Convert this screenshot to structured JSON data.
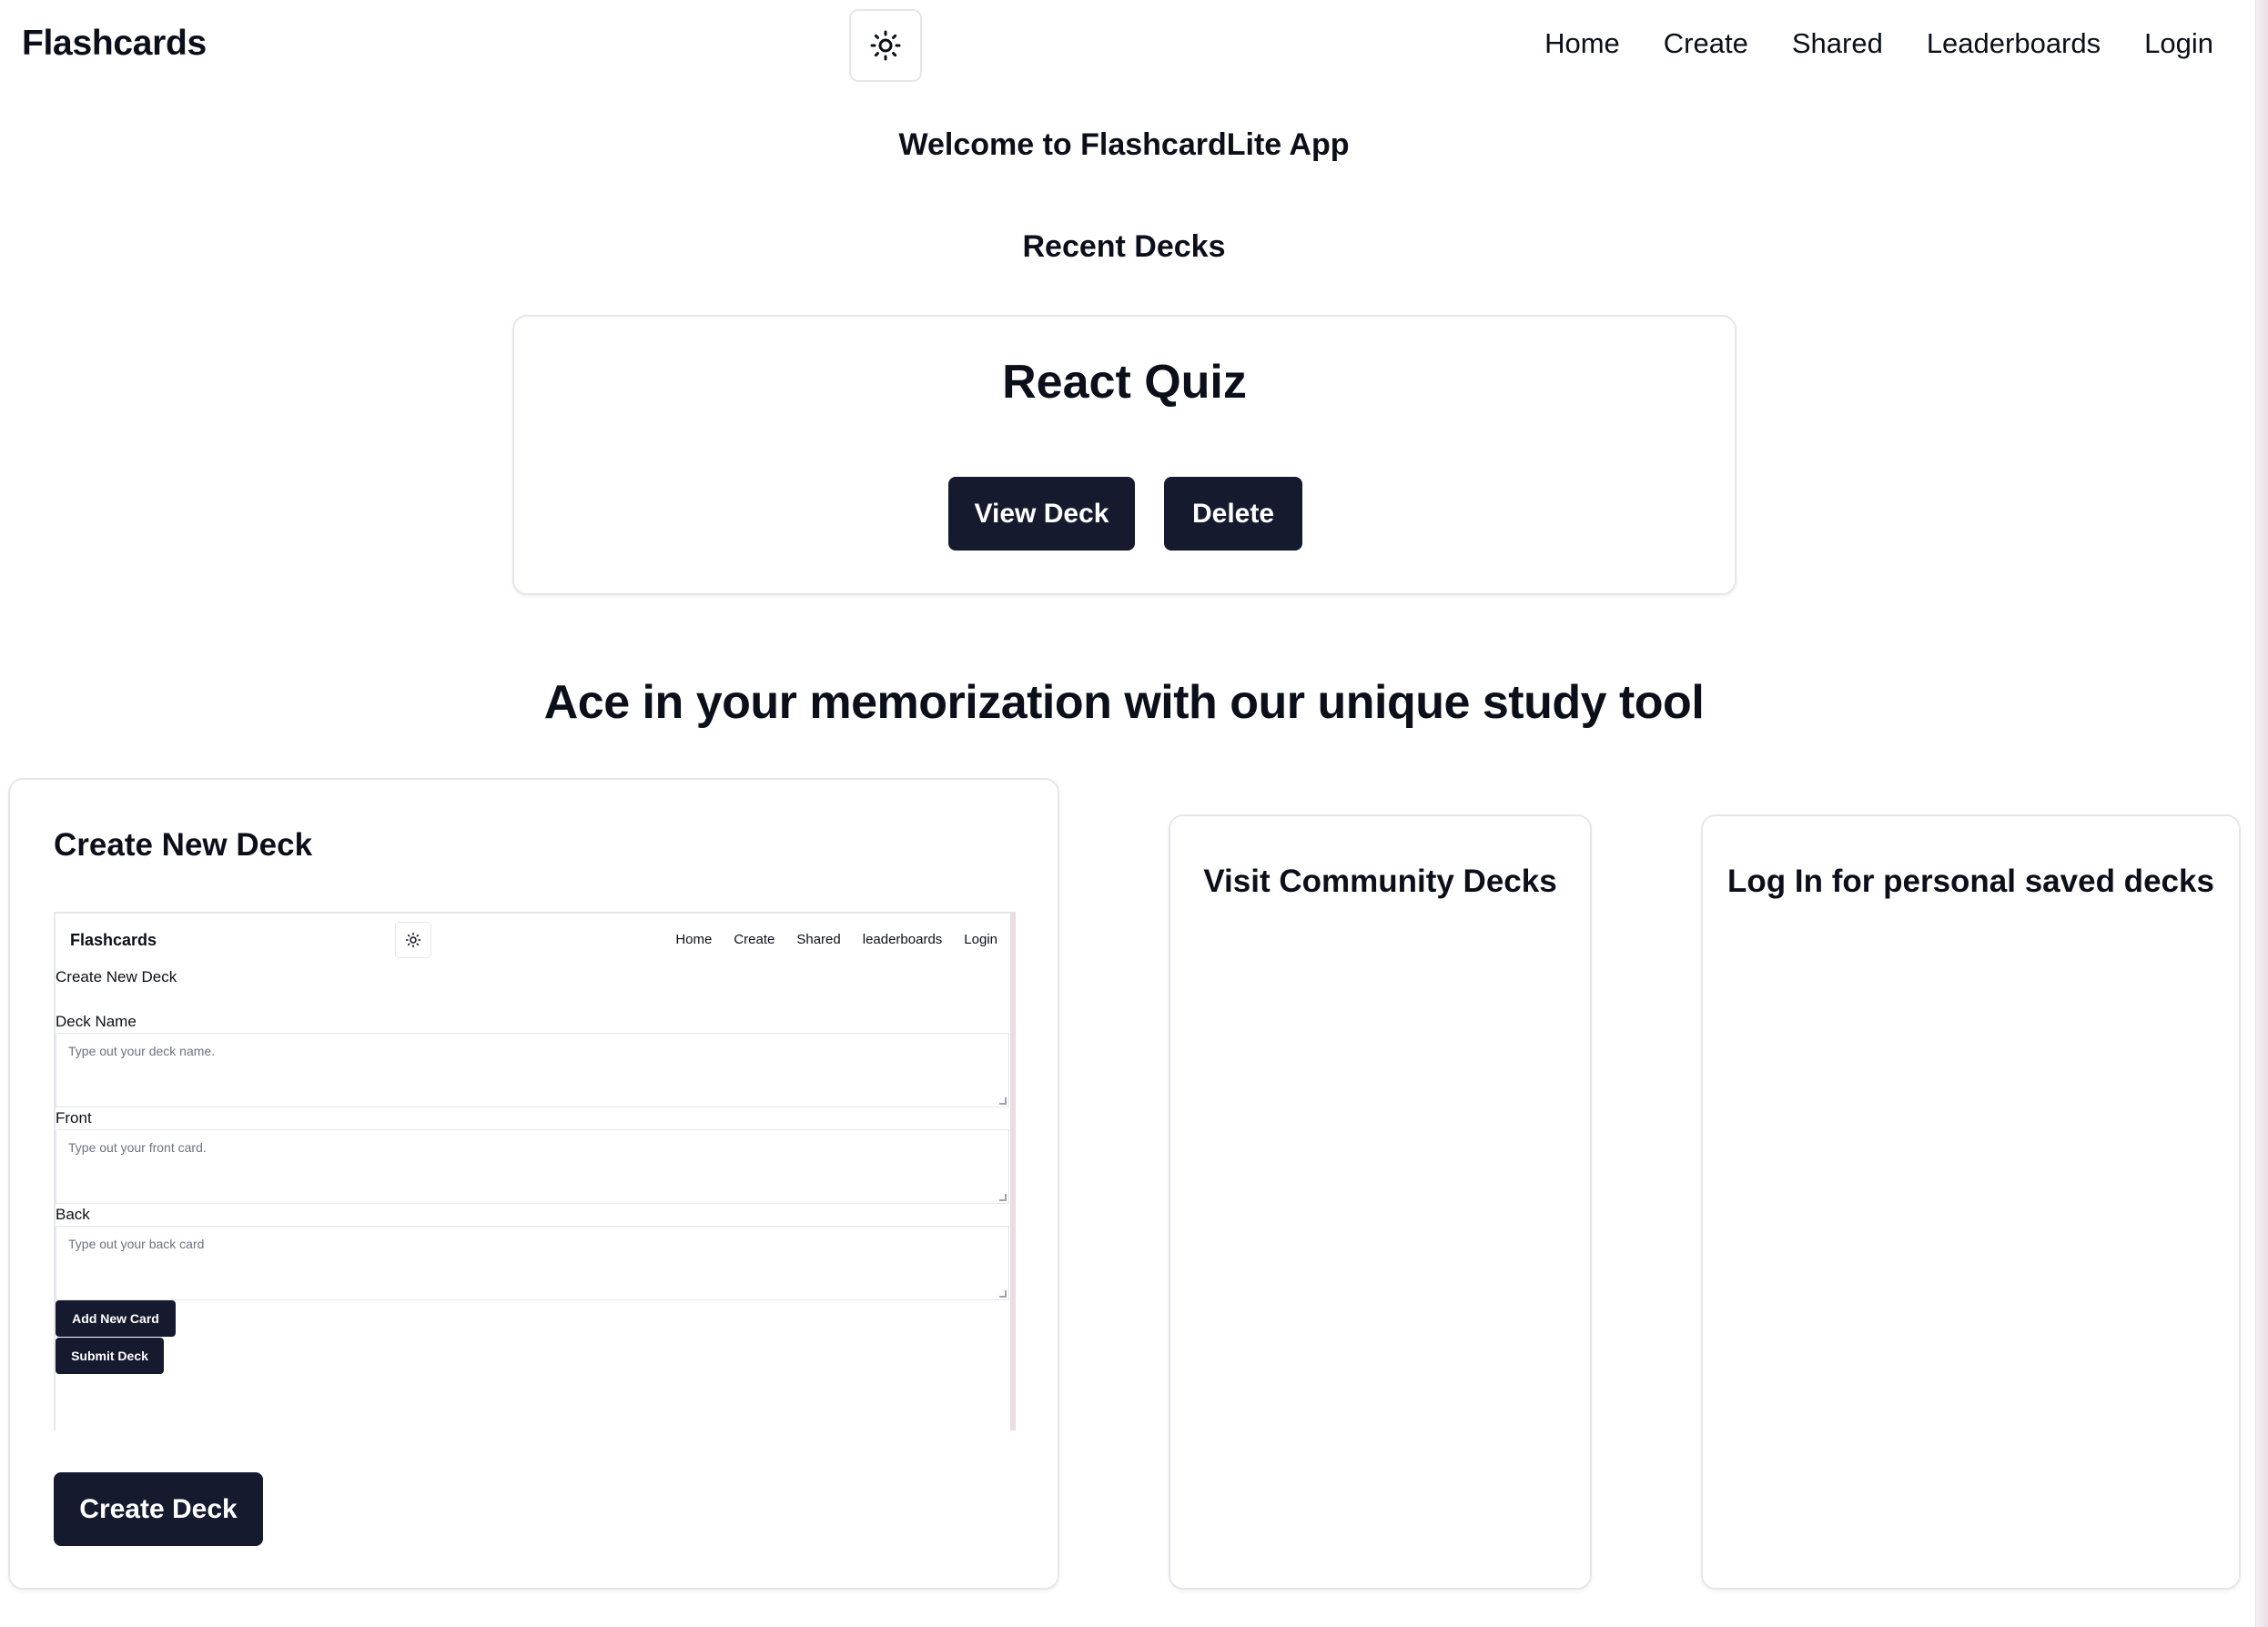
{
  "header": {
    "brand": "Flashcards",
    "theme_icon": "sun-icon",
    "nav": [
      "Home",
      "Create",
      "Shared",
      "Leaderboards",
      "Login"
    ]
  },
  "main": {
    "welcome": "Welcome to FlashcardLite App",
    "recent_heading": "Recent Decks",
    "deck": {
      "title": "React Quiz",
      "view_label": "View Deck",
      "delete_label": "Delete"
    },
    "tagline": "Ace in your memorization with our unique study tool"
  },
  "features": {
    "create": {
      "title": "Create New Deck",
      "button_label": "Create Deck",
      "preview": {
        "brand": "Flashcards",
        "nav": [
          "Home",
          "Create",
          "Shared",
          "leaderboards",
          "Login"
        ],
        "heading": "Create New Deck",
        "deck_name_label": "Deck Name",
        "deck_name_placeholder": "Type out your deck name.",
        "front_label": "Front",
        "front_placeholder": "Type out your front card.",
        "back_label": "Back",
        "back_placeholder": "Type out your back card",
        "add_card_label": "Add New Card",
        "submit_label": "Submit Deck"
      }
    },
    "community": {
      "title": "Visit Community Decks"
    },
    "login": {
      "title": "Log In for personal saved decks"
    }
  },
  "colors": {
    "button_bg": "#151a2e",
    "text": "#0b0f1a",
    "border": "#e5e7eb"
  }
}
